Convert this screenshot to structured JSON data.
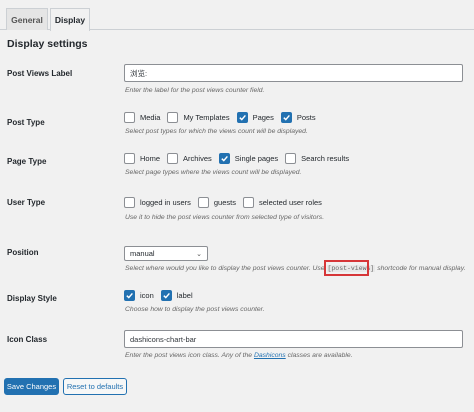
{
  "tabs": [
    {
      "label": "General"
    },
    {
      "label": "Display"
    }
  ],
  "section_title": "Display settings",
  "post_views_label": {
    "label": "Post Views Label",
    "value": "浏览:",
    "description": "Enter the label for the post views counter field."
  },
  "post_type": {
    "label": "Post Type",
    "options": [
      {
        "label": "Media",
        "checked": false
      },
      {
        "label": "My Templates",
        "checked": false
      },
      {
        "label": "Pages",
        "checked": true
      },
      {
        "label": "Posts",
        "checked": true
      }
    ],
    "description": "Select post types for which the views count will be displayed."
  },
  "page_type": {
    "label": "Page Type",
    "options": [
      {
        "label": "Home",
        "checked": false
      },
      {
        "label": "Archives",
        "checked": false
      },
      {
        "label": "Single pages",
        "checked": true
      },
      {
        "label": "Search results",
        "checked": false
      }
    ],
    "description": "Select page types where the views count will be displayed."
  },
  "user_type": {
    "label": "User Type",
    "options": [
      {
        "label": "logged in users",
        "checked": false
      },
      {
        "label": "guests",
        "checked": false
      },
      {
        "label": "selected user roles",
        "checked": false
      }
    ],
    "description": "Use it to hide the post views counter from selected type of visitors."
  },
  "position": {
    "label": "Position",
    "selected": "manual",
    "description_before": "Select where would you like to display the post views counter. Use",
    "shortcode": "[post-views]",
    "description_after": "shortcode for manual display."
  },
  "display_style": {
    "label": "Display Style",
    "options": [
      {
        "label": "icon",
        "checked": true
      },
      {
        "label": "label",
        "checked": true
      }
    ],
    "description": "Choose how to display the post views counter."
  },
  "icon_class": {
    "label": "Icon Class",
    "value": "dashicons-chart-bar",
    "description_before": "Enter the post views icon class. Any of the",
    "link": "Dashicons",
    "description_after": "classes are available."
  },
  "buttons": {
    "save": "Save Changes",
    "reset": "Reset to defaults"
  },
  "colors": {
    "accent": "#2271b1",
    "highlight": "#d63638"
  }
}
